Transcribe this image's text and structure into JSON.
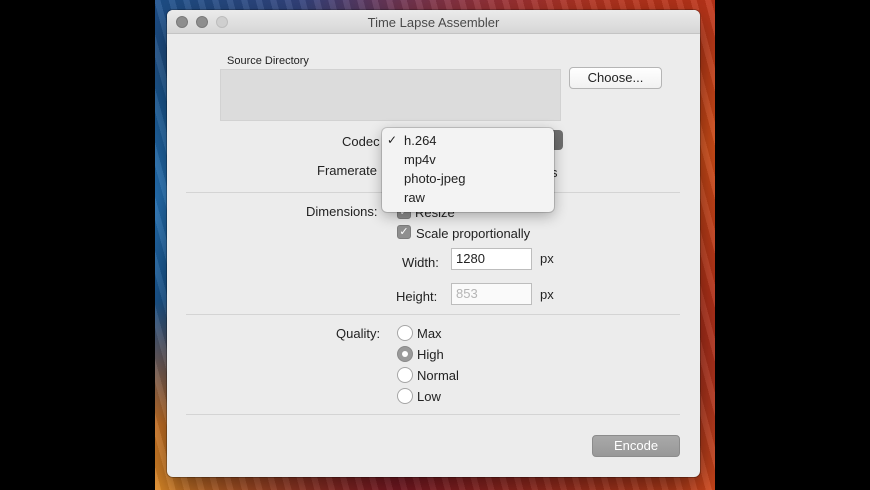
{
  "window": {
    "title": "Time Lapse Assembler"
  },
  "source": {
    "label": "Source Directory",
    "choose_label": "Choose..."
  },
  "codec": {
    "label": "Codec",
    "options": [
      {
        "label": "h.264",
        "checked": true
      },
      {
        "label": "mp4v",
        "checked": false
      },
      {
        "label": "photo-jpeg",
        "checked": false
      },
      {
        "label": "raw",
        "checked": false
      }
    ],
    "check_mark": "✓"
  },
  "framerate": {
    "label": "Framerate",
    "suffix": "s"
  },
  "dimensions": {
    "label": "Dimensions:",
    "resize_label": "Resize",
    "resize_checked": true,
    "scale_label": "Scale proportionally",
    "scale_checked": true,
    "width_label": "Width:",
    "width_value": "1280",
    "height_label": "Height:",
    "height_value": "853",
    "unit": "px"
  },
  "quality": {
    "label": "Quality:",
    "options": [
      "Max",
      "High",
      "Normal",
      "Low"
    ],
    "selected": "High"
  },
  "encode_label": "Encode",
  "checkmark_glyph": "✓"
}
